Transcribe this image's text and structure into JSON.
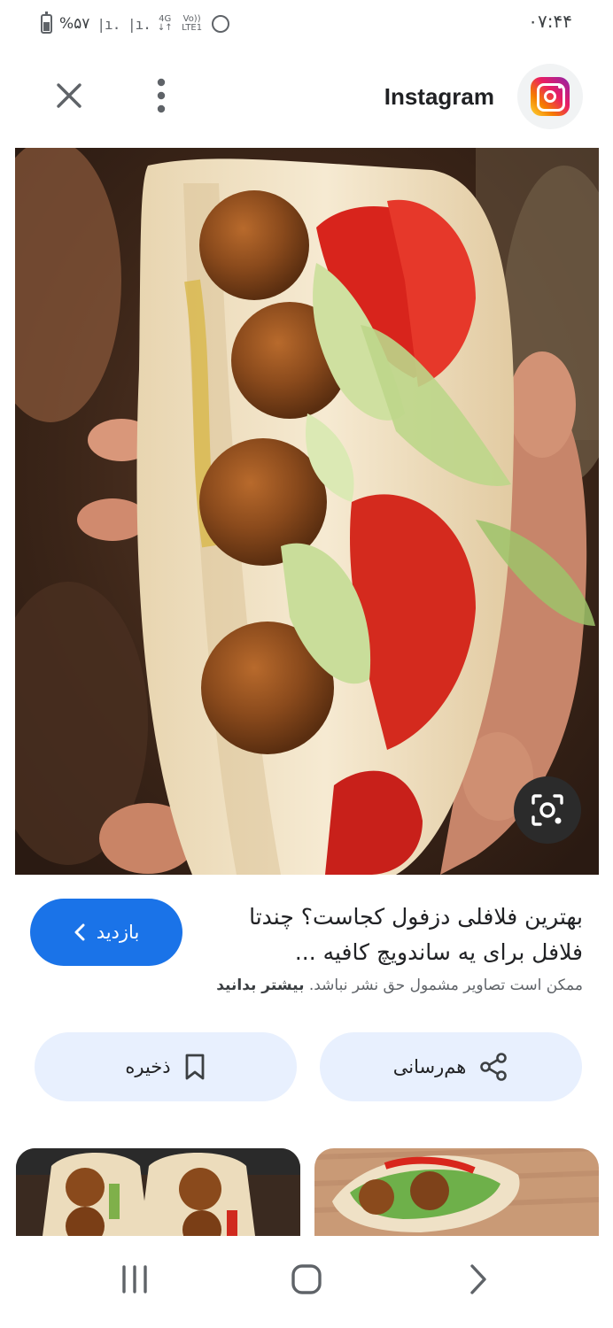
{
  "status_bar": {
    "battery": "%۵۷",
    "signal": "|ı. |ı.",
    "network": "4G",
    "volte": "Vo)) LTE1",
    "time": "۰۷:۴۴"
  },
  "header": {
    "close_icon": "close-icon",
    "more_icon": "more-vert-icon",
    "source_name": "Instagram",
    "source_logo": "instagram-logo"
  },
  "result": {
    "visit_label": "بازدید",
    "visit_icon": "chevron-left-icon",
    "title": "بهترین فلافلی دزفول کجاست؟ چندتا فلافل برای یه ساندویچ کافیه ...",
    "copyright_text": "ممکن است تصاویر مشمول حق نشر نباشد.",
    "learn_more": "بیشتر بدانید"
  },
  "actions": {
    "save_label": "ذخیره",
    "save_icon": "bookmark-icon",
    "share_label": "هم‌رسانی",
    "share_icon": "share-icon"
  },
  "lens_icon": "lens-camera-icon",
  "nav": {
    "recents_icon": "recents-icon",
    "home_icon": "home-icon",
    "back_icon": "back-icon"
  },
  "colors": {
    "accent": "#1a73e8",
    "chip_bg": "#e8f0fe"
  }
}
